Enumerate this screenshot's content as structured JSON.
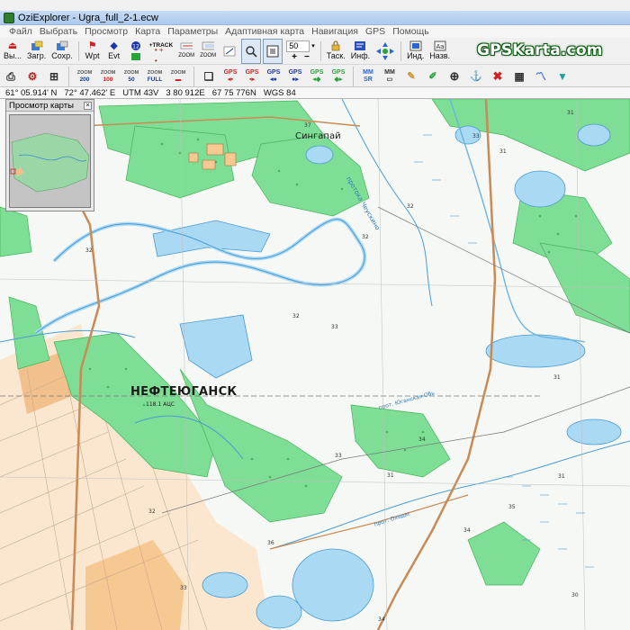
{
  "window": {
    "title": "OziExplorer - Ugra_full_2-1.ecw"
  },
  "menu": [
    "Файл",
    "Выбрать",
    "Просмотр",
    "Карта",
    "Параметры",
    "Адаптивная карта",
    "Навигация",
    "GPS",
    "Помощь"
  ],
  "toolbar1": {
    "exit": "Вы...",
    "load": "Загр.",
    "save": "Сохр.",
    "wpt": "Wpt",
    "evt": "Evt",
    "track": "+TRACK",
    "zoom_value": "50",
    "task": "Таск.",
    "info": "Инф.",
    "ind": "Инд.",
    "nav": "Назв."
  },
  "toolbar2": {
    "zoom_200": "200",
    "zoom_100": "100",
    "zoom_50": "50",
    "zoom_full": "FULL",
    "zoom_word": "ZOOM"
  },
  "brand": "GPSKarta.com",
  "status": {
    "lat": "61° 05.914' N",
    "lon": "72° 47.462' E",
    "utm": "UTM  43V",
    "east": "3 80 912E",
    "north": "67 75 776N",
    "datum": "WGS 84"
  },
  "preview": {
    "title": "Просмотр карты"
  },
  "map": {
    "city": "НЕФТЕЮГАНСК",
    "village": "Сингапай",
    "river1": "протока Чеускино",
    "river2": "прот. Юганская Обь",
    "river3": "прот. Оходас",
    "spot_height": "118.1 АЦС",
    "heights": [
      "32",
      "31",
      "33",
      "32",
      "31",
      "34",
      "36",
      "33",
      "31",
      "32",
      "35",
      "34",
      "30",
      "32",
      "33",
      "31",
      "33",
      "37",
      "34",
      "31",
      "32"
    ]
  },
  "colors": {
    "forest": "#7ede95",
    "forest_dark": "#46b35c",
    "water": "#aad9f4",
    "water_line": "#4a9bd5",
    "road": "#c98a55",
    "urban": "#f6c892",
    "brand_green": "#0c5a12"
  }
}
